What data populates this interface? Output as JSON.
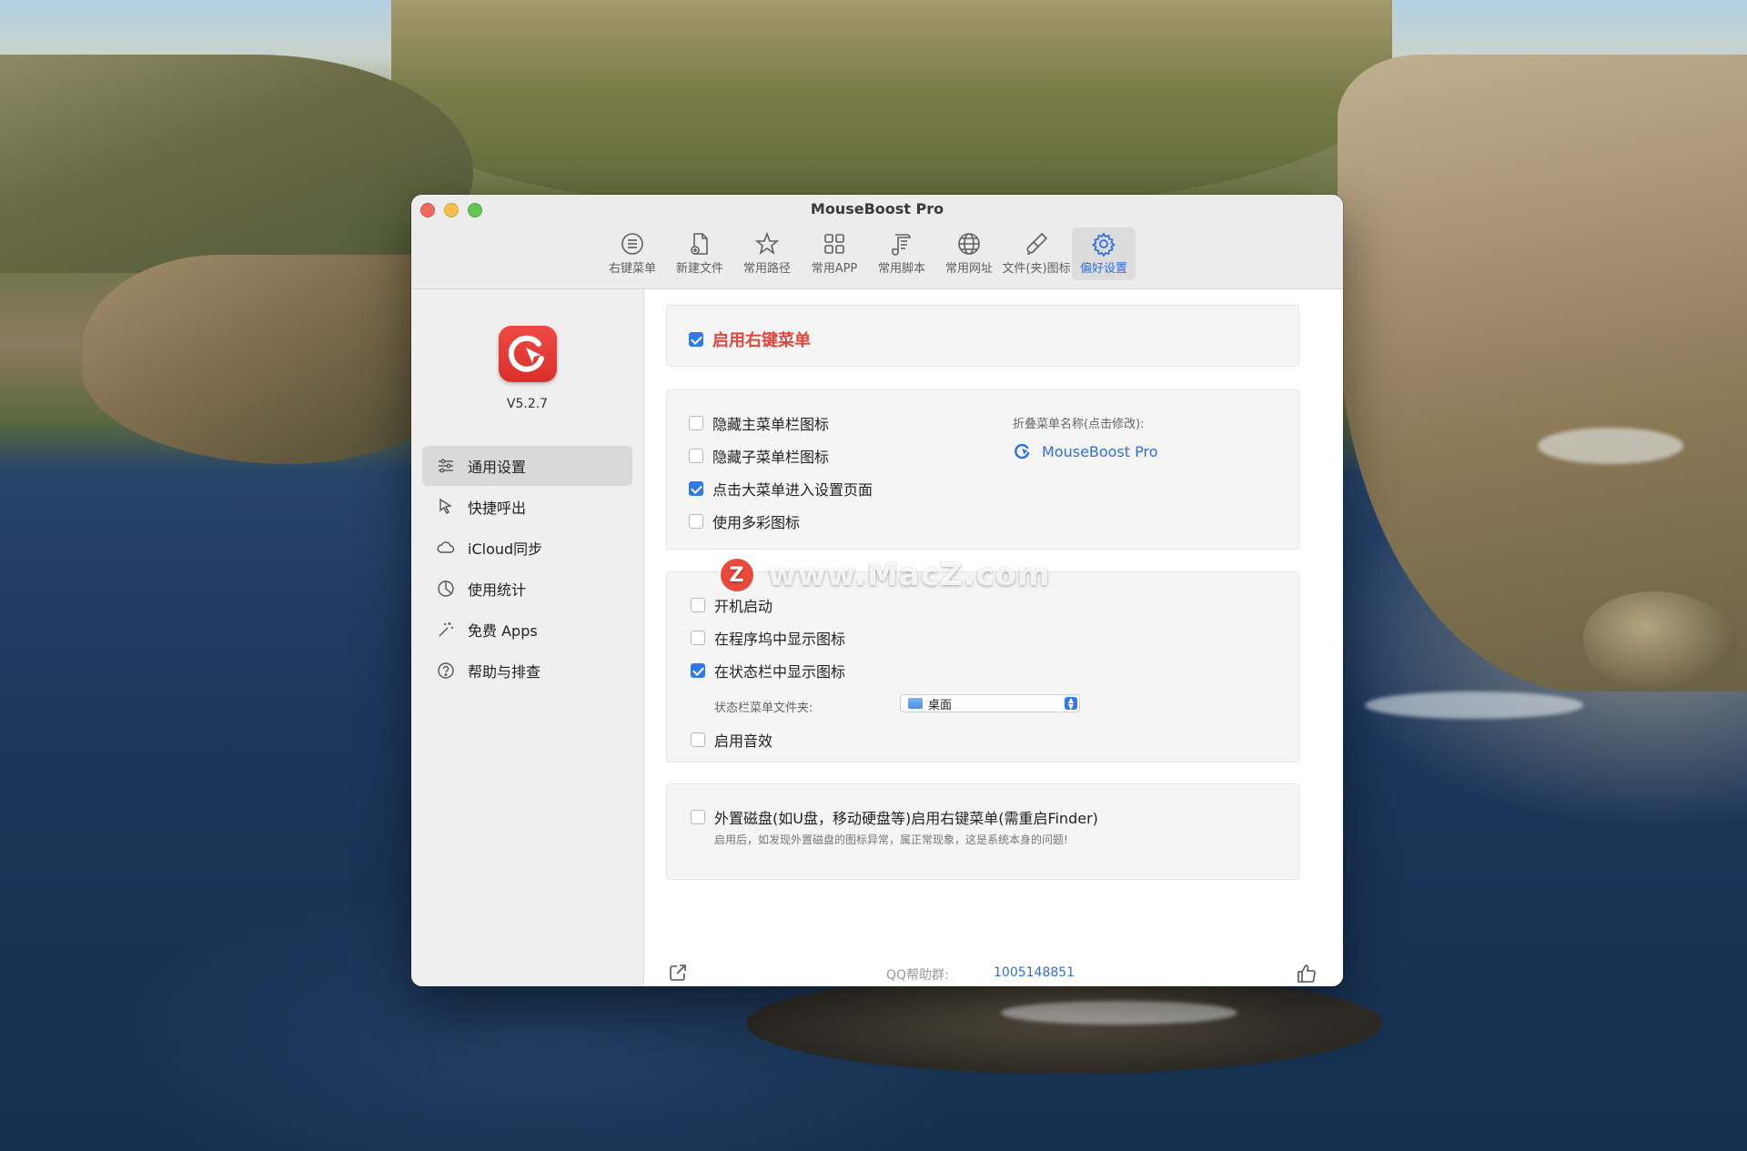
{
  "window": {
    "title": "MouseBoost Pro"
  },
  "toolbar": {
    "items": [
      {
        "label": "右键菜单",
        "icon": "list-icon"
      },
      {
        "label": "新建文件",
        "icon": "new-file-icon"
      },
      {
        "label": "常用路径",
        "icon": "star-icon"
      },
      {
        "label": "常用APP",
        "icon": "grid-icon"
      },
      {
        "label": "常用脚本",
        "icon": "script-icon"
      },
      {
        "label": "常用网址",
        "icon": "globe-icon"
      },
      {
        "label": "文件(夹)图标",
        "icon": "brush-icon"
      },
      {
        "label": "偏好设置",
        "icon": "gear-icon",
        "active": true
      }
    ]
  },
  "sidebar": {
    "version": "V5.2.7",
    "items": [
      {
        "label": "通用设置",
        "icon": "sliders-icon",
        "active": true
      },
      {
        "label": "快捷呼出",
        "icon": "cursor-icon"
      },
      {
        "label": "iCloud同步",
        "icon": "cloud-icon"
      },
      {
        "label": "使用统计",
        "icon": "pie-chart-icon"
      },
      {
        "label": "免费 Apps",
        "icon": "magic-wand-icon"
      },
      {
        "label": "帮助与排查",
        "icon": "help-icon"
      }
    ]
  },
  "settings": {
    "enable_context_menu": {
      "label": "启用右键菜单",
      "checked": true
    },
    "menu_options": [
      {
        "label": "隐藏主菜单栏图标",
        "checked": false
      },
      {
        "label": "隐藏子菜单栏图标",
        "checked": false
      },
      {
        "label": "点击大菜单进入设置页面",
        "checked": true
      },
      {
        "label": "使用多彩图标",
        "checked": false
      }
    ],
    "fold_menu_name_label": "折叠菜单名称(点击修改):",
    "fold_menu_name_value": "MouseBoost Pro",
    "system_options": [
      {
        "label": "开机启动",
        "checked": false
      },
      {
        "label": "在程序坞中显示图标",
        "checked": false
      },
      {
        "label": "在状态栏中显示图标",
        "checked": true
      }
    ],
    "status_bar_folder_label": "状态栏菜单文件夹:",
    "status_bar_folder_value": "桌面",
    "sound_option": {
      "label": "启用音效",
      "checked": false
    },
    "external_disk": {
      "label": "外置磁盘(如U盘，移动硬盘等)启用右键菜单(需重启Finder)",
      "checked": false,
      "note": "启用后，如发现外置磁盘的图标异常，属正常现象，这是系统本身的问题!"
    }
  },
  "footer": {
    "qq_label": "QQ帮助群:",
    "qq_value": "1005148851"
  },
  "watermark": {
    "logo": "Z",
    "text": "www.MacZ.com"
  },
  "colors": {
    "accent": "#2f6fe0",
    "enable_red": "#e0463c",
    "checkbox_blue": "#2f79ea"
  }
}
